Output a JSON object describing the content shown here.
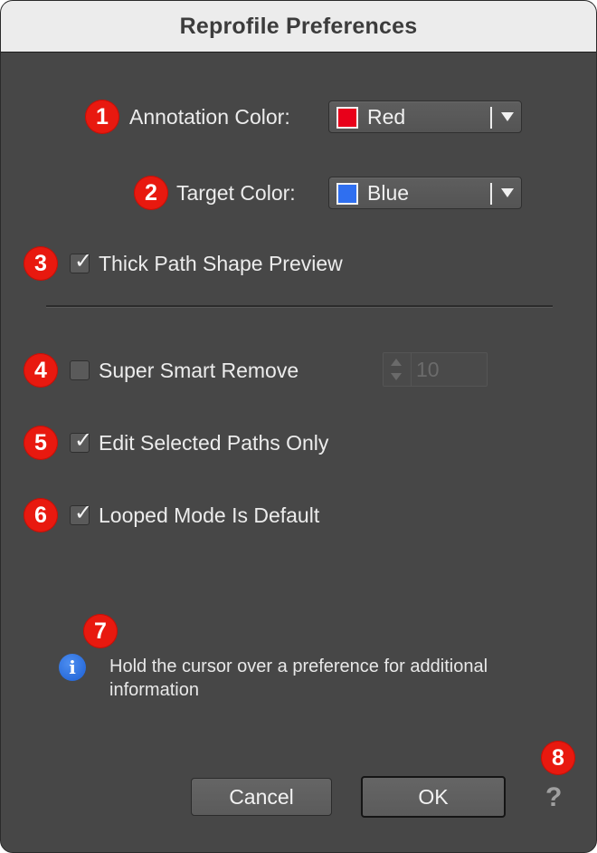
{
  "window": {
    "title": "Reprofile Preferences"
  },
  "badges": [
    "1",
    "2",
    "3",
    "4",
    "5",
    "6",
    "7",
    "8"
  ],
  "annotation_color": {
    "label": "Annotation Color:",
    "value": "Red",
    "swatch": "#e8001a"
  },
  "target_color": {
    "label": "Target Color:",
    "value": "Blue",
    "swatch": "#2f6ff0"
  },
  "options": {
    "thick_path": {
      "label": "Thick Path Shape Preview",
      "checked": true
    },
    "super_smart_remove": {
      "label": "Super Smart Remove",
      "checked": false,
      "stepper_value": "10"
    },
    "edit_selected": {
      "label": "Edit Selected Paths Only",
      "checked": true
    },
    "looped_mode": {
      "label": "Looped Mode Is Default",
      "checked": true
    }
  },
  "info": {
    "icon": "info-icon",
    "text": "Hold the cursor over a preference for additional information"
  },
  "buttons": {
    "cancel": "Cancel",
    "ok": "OK"
  },
  "help": {
    "icon": "question-mark-icon",
    "glyph": "?"
  },
  "colors": {
    "badge": "#e8190f",
    "background": "#474747",
    "titlebar": "#ececec"
  }
}
